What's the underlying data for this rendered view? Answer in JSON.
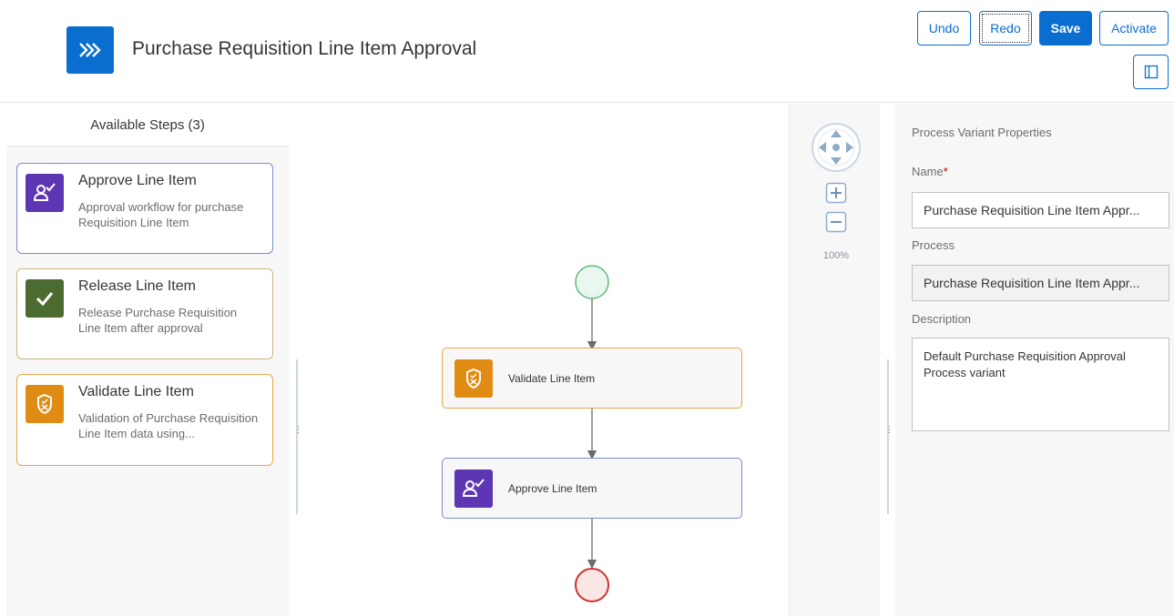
{
  "header": {
    "title": "Purchase Requisition Line Item Approval",
    "app_icon": "double-chevron-right-icon",
    "buttons": {
      "undo": "Undo",
      "redo": "Redo",
      "save": "Save",
      "activate": "Activate"
    },
    "toggle_panel_icon": "side-panel-icon"
  },
  "available_steps": {
    "heading": "Available Steps (3)",
    "items": [
      {
        "title": "Approve Line Item",
        "description": "Approval workflow for purchase Requisition Line Item",
        "icon": "user-approve-icon",
        "color": "#5d36b4"
      },
      {
        "title": "Release Line Item",
        "description": "Release Purchase Requisition Line Item after approval",
        "icon": "checkmark-icon",
        "color": "#4c6b31"
      },
      {
        "title": "Validate Line Item",
        "description": "Validation of Purchase Requisition Line Item data using...",
        "icon": "shield-validate-icon",
        "color": "#e08b14"
      }
    ]
  },
  "canvas": {
    "nodes": [
      {
        "label": "Validate Line Item",
        "icon": "shield-validate-icon",
        "color": "#e08b14"
      },
      {
        "label": "Approve Line Item",
        "icon": "user-approve-icon",
        "color": "#5d36b4"
      }
    ],
    "zoom": "100%"
  },
  "properties": {
    "heading": "Process Variant Properties",
    "name_label": "Name",
    "required_mark": "*",
    "name_value": "Purchase Requisition Line Item Appr...",
    "process_label": "Process",
    "process_value": "Purchase Requisition Line Item Appr...",
    "description_label": "Description",
    "description_value": "Default Purchase Requisition Approval Process variant"
  },
  "colors": {
    "accent": "#0a6ed1",
    "start_event": "#27ae60",
    "end_event": "#d0312d"
  }
}
